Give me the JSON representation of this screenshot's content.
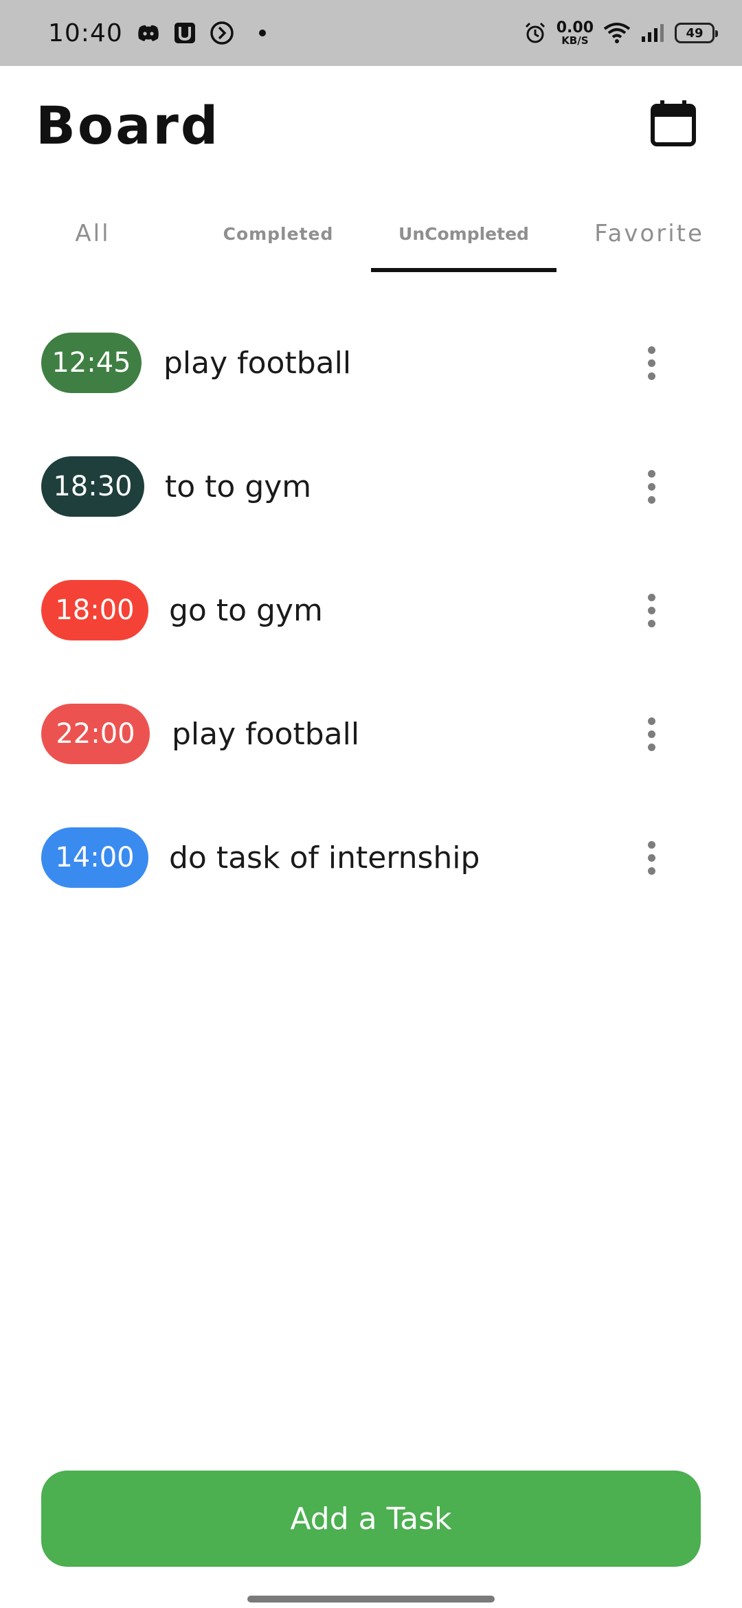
{
  "status_bar": {
    "time": "10:40",
    "net_speed_value": "0.00",
    "net_speed_unit": "KB/S",
    "battery_level": "49"
  },
  "header": {
    "title": "Board",
    "calendar_icon": "calendar-icon"
  },
  "tabs": [
    {
      "label": "All",
      "selected": false
    },
    {
      "label": "Completed",
      "selected": false
    },
    {
      "label": "UnCompleted",
      "selected": true
    },
    {
      "label": "Favorite",
      "selected": false
    }
  ],
  "tasks": [
    {
      "time": "12:45",
      "title": "play football",
      "color": "#3f7f43"
    },
    {
      "time": "18:30",
      "title": "to to gym",
      "color": "#1e3f3c"
    },
    {
      "time": "18:00",
      "title": "go to gym",
      "color": "#f44336"
    },
    {
      "time": "22:00",
      "title": "play football",
      "color": "#ec5350"
    },
    {
      "time": "14:00",
      "title": "do task of internship",
      "color": "#3a8bf0"
    }
  ],
  "footer": {
    "add_task_label": "Add a Task",
    "accent_color": "#4caf50"
  }
}
